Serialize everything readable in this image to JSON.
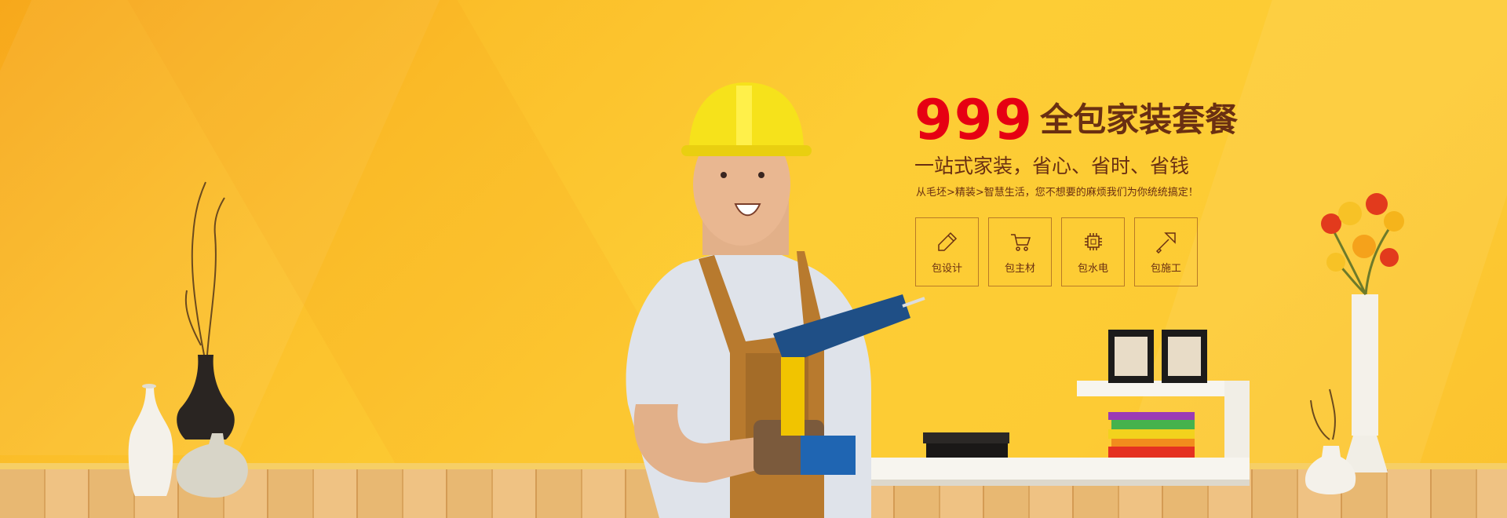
{
  "banner": {
    "price": "999",
    "headline": "全包家装套餐",
    "subline": "一站式家装，省心、省时、省钱",
    "description": "从毛坯>精装>智慧生活，您不想要的麻烦我们为你统统搞定！",
    "services": [
      {
        "label": "包设计",
        "icon": "pencil-icon"
      },
      {
        "label": "包主材",
        "icon": "cart-icon"
      },
      {
        "label": "包水电",
        "icon": "chip-icon"
      },
      {
        "label": "包施工",
        "icon": "trowel-icon"
      }
    ]
  },
  "colors": {
    "background": "#fdcb34",
    "price": "#e60012",
    "text": "#6a2f12",
    "border": "#b97a26"
  }
}
